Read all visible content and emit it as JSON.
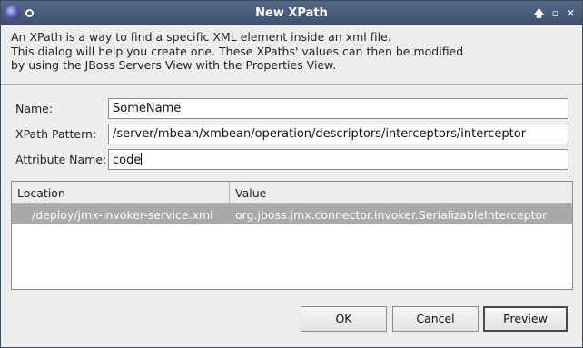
{
  "window": {
    "title": "New XPath",
    "buttons": {
      "up": "🡅",
      "maximize": "▫",
      "close": "✕"
    }
  },
  "description": [
    "An XPath is a way to find a specific XML element inside an xml file.",
    "This dialog will help you create one. These XPaths' values can then be modified",
    "by using the JBoss Servers View with the Properties View."
  ],
  "form": {
    "name_label": "Name:",
    "name_value": "SomeName",
    "pattern_label": "XPath Pattern:",
    "pattern_value": "/server/mbean/xmbean/operation/descriptors/interceptors/interceptor",
    "attribute_label": "Attribute Name:",
    "attribute_value": "code"
  },
  "table": {
    "columns": [
      "Location",
      "Value"
    ],
    "rows": [
      {
        "location": "/deploy/jmx-invoker-service.xml",
        "value": "org.jboss.jmx.connector.invoker.SerializableInterceptor"
      }
    ]
  },
  "actions": {
    "ok": "OK",
    "cancel": "Cancel",
    "preview": "Preview"
  }
}
